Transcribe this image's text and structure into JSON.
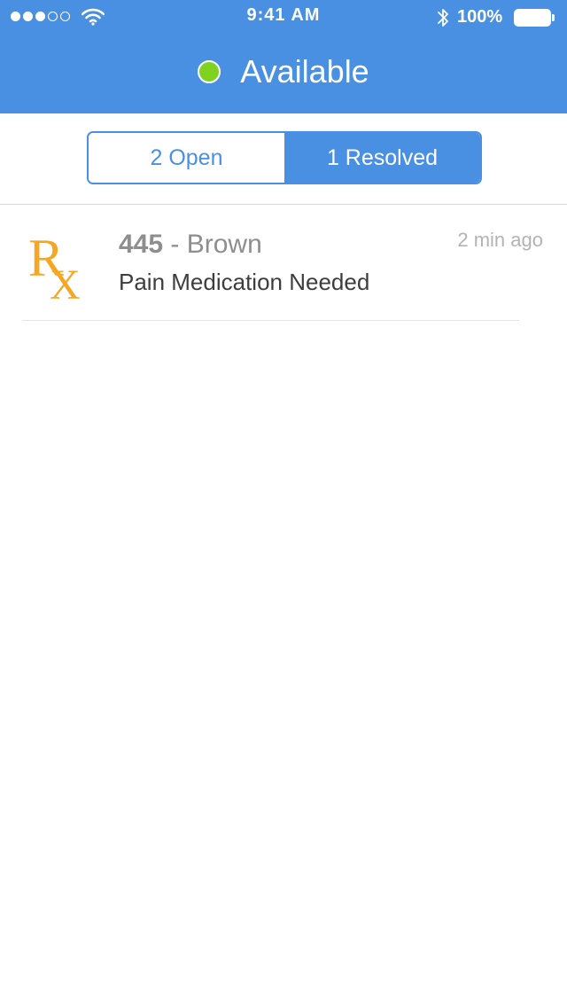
{
  "status_bar": {
    "time": "9:41 AM",
    "battery_text": "100%",
    "signal_filled": 3,
    "signal_total": 5
  },
  "header": {
    "title": "Available",
    "status_color": "#7ed321",
    "background_color": "#4a90e2"
  },
  "tabs": [
    {
      "label": "2 Open",
      "active": false
    },
    {
      "label": "1 Resolved",
      "active": true
    }
  ],
  "requests": [
    {
      "icon": "rx-icon",
      "room": "445",
      "separator": " - ",
      "name": "Brown",
      "time": "2 min ago",
      "description": "Pain Medication Needed"
    }
  ]
}
